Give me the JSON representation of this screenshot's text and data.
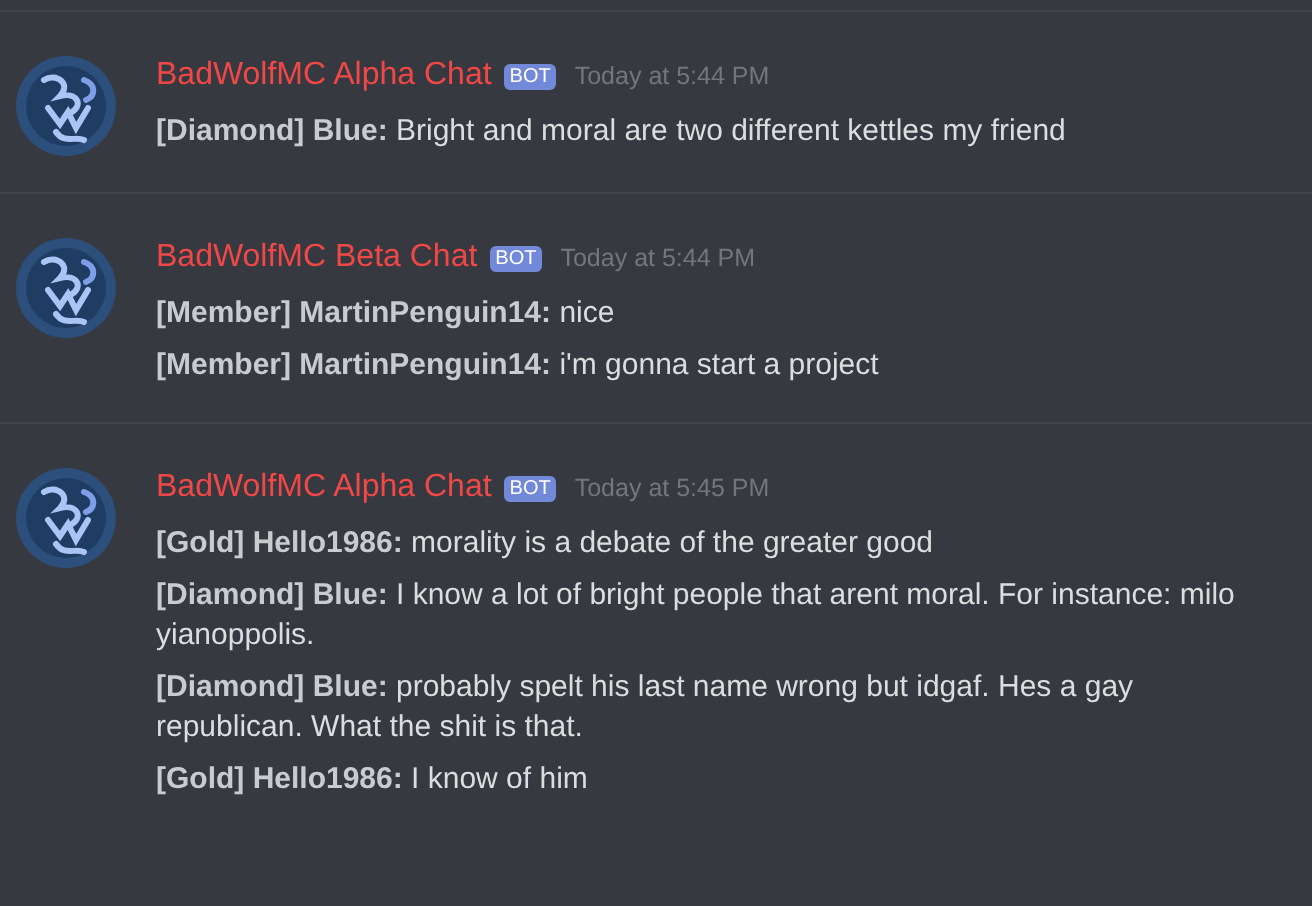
{
  "groups": [
    {
      "author": "BadWolfMC Alpha Chat",
      "badge": "BOT",
      "time": "Today at 5:44 PM",
      "messages": [
        "**[Diamond] Blue:** Bright and moral are two different kettles my friend"
      ]
    },
    {
      "author": "BadWolfMC Beta Chat",
      "badge": "BOT",
      "time": "Today at 5:44 PM",
      "messages": [
        "**[Member] MartinPenguin14:** nice",
        "**[Member] MartinPenguin14:** i'm gonna start a project"
      ]
    },
    {
      "author": "BadWolfMC Alpha Chat",
      "badge": "BOT",
      "time": "Today at 5:45 PM",
      "messages": [
        "**[Gold] Hello1986:** morality is a debate of the greater good",
        "**[Diamond] Blue:** I know a lot of bright people that arent moral. For instance: milo yianoppolis.",
        "**[Diamond] Blue:** probably spelt his last name wrong but idgaf. Hes a gay republican. What the shit is that.",
        "**[Gold] Hello1986:** I know of him"
      ]
    }
  ]
}
